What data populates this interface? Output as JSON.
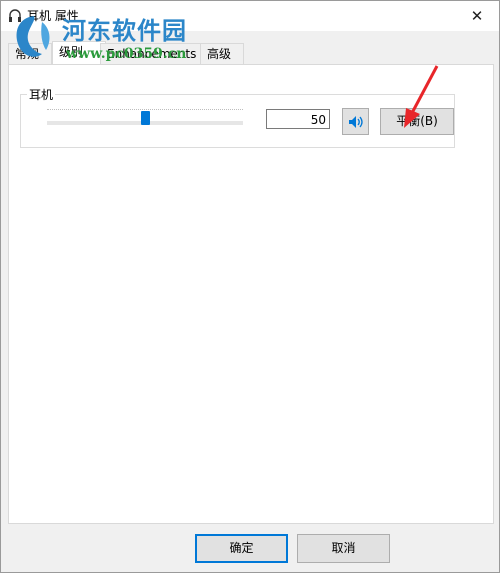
{
  "window": {
    "title": "耳机 属性",
    "close_glyph": "✕"
  },
  "tabs": [
    {
      "label": "常规",
      "active": false
    },
    {
      "label": "级别",
      "active": true
    },
    {
      "label": "Enhancements",
      "active": false
    },
    {
      "label": "高级",
      "active": false
    }
  ],
  "levels": {
    "group_label": "耳机",
    "slider_level": 0.5,
    "value": "50",
    "balance_label": "平衡(B)"
  },
  "watermark": {
    "title": "河东软件园",
    "url": "www.pc0359.cn"
  },
  "footer": {
    "ok_label": "确定",
    "cancel_label": "取消"
  },
  "colors": {
    "accent": "#0078d7",
    "annotation_arrow": "#e8262a"
  },
  "icons": [
    "headphones-icon",
    "close-icon",
    "speaker-icon",
    "watermark-logo"
  ]
}
